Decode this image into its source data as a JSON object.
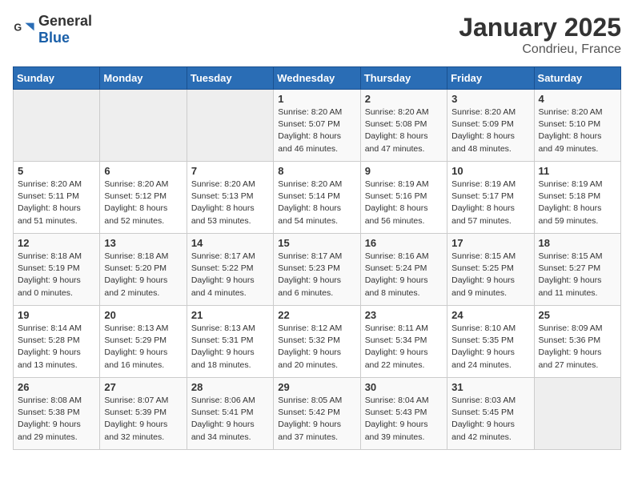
{
  "header": {
    "logo_general": "General",
    "logo_blue": "Blue",
    "month_title": "January 2025",
    "location": "Condrieu, France"
  },
  "days_of_week": [
    "Sunday",
    "Monday",
    "Tuesday",
    "Wednesday",
    "Thursday",
    "Friday",
    "Saturday"
  ],
  "weeks": [
    [
      {
        "day": "",
        "empty": true
      },
      {
        "day": "",
        "empty": true
      },
      {
        "day": "",
        "empty": true
      },
      {
        "day": "1",
        "sunrise": "8:20 AM",
        "sunset": "5:07 PM",
        "daylight": "8 hours and 46 minutes."
      },
      {
        "day": "2",
        "sunrise": "8:20 AM",
        "sunset": "5:08 PM",
        "daylight": "8 hours and 47 minutes."
      },
      {
        "day": "3",
        "sunrise": "8:20 AM",
        "sunset": "5:09 PM",
        "daylight": "8 hours and 48 minutes."
      },
      {
        "day": "4",
        "sunrise": "8:20 AM",
        "sunset": "5:10 PM",
        "daylight": "8 hours and 49 minutes."
      }
    ],
    [
      {
        "day": "5",
        "sunrise": "8:20 AM",
        "sunset": "5:11 PM",
        "daylight": "8 hours and 51 minutes."
      },
      {
        "day": "6",
        "sunrise": "8:20 AM",
        "sunset": "5:12 PM",
        "daylight": "8 hours and 52 minutes."
      },
      {
        "day": "7",
        "sunrise": "8:20 AM",
        "sunset": "5:13 PM",
        "daylight": "8 hours and 53 minutes."
      },
      {
        "day": "8",
        "sunrise": "8:20 AM",
        "sunset": "5:14 PM",
        "daylight": "8 hours and 54 minutes."
      },
      {
        "day": "9",
        "sunrise": "8:19 AM",
        "sunset": "5:16 PM",
        "daylight": "8 hours and 56 minutes."
      },
      {
        "day": "10",
        "sunrise": "8:19 AM",
        "sunset": "5:17 PM",
        "daylight": "8 hours and 57 minutes."
      },
      {
        "day": "11",
        "sunrise": "8:19 AM",
        "sunset": "5:18 PM",
        "daylight": "8 hours and 59 minutes."
      }
    ],
    [
      {
        "day": "12",
        "sunrise": "8:18 AM",
        "sunset": "5:19 PM",
        "daylight": "9 hours and 0 minutes."
      },
      {
        "day": "13",
        "sunrise": "8:18 AM",
        "sunset": "5:20 PM",
        "daylight": "9 hours and 2 minutes."
      },
      {
        "day": "14",
        "sunrise": "8:17 AM",
        "sunset": "5:22 PM",
        "daylight": "9 hours and 4 minutes."
      },
      {
        "day": "15",
        "sunrise": "8:17 AM",
        "sunset": "5:23 PM",
        "daylight": "9 hours and 6 minutes."
      },
      {
        "day": "16",
        "sunrise": "8:16 AM",
        "sunset": "5:24 PM",
        "daylight": "9 hours and 8 minutes."
      },
      {
        "day": "17",
        "sunrise": "8:15 AM",
        "sunset": "5:25 PM",
        "daylight": "9 hours and 9 minutes."
      },
      {
        "day": "18",
        "sunrise": "8:15 AM",
        "sunset": "5:27 PM",
        "daylight": "9 hours and 11 minutes."
      }
    ],
    [
      {
        "day": "19",
        "sunrise": "8:14 AM",
        "sunset": "5:28 PM",
        "daylight": "9 hours and 13 minutes."
      },
      {
        "day": "20",
        "sunrise": "8:13 AM",
        "sunset": "5:29 PM",
        "daylight": "9 hours and 16 minutes."
      },
      {
        "day": "21",
        "sunrise": "8:13 AM",
        "sunset": "5:31 PM",
        "daylight": "9 hours and 18 minutes."
      },
      {
        "day": "22",
        "sunrise": "8:12 AM",
        "sunset": "5:32 PM",
        "daylight": "9 hours and 20 minutes."
      },
      {
        "day": "23",
        "sunrise": "8:11 AM",
        "sunset": "5:34 PM",
        "daylight": "9 hours and 22 minutes."
      },
      {
        "day": "24",
        "sunrise": "8:10 AM",
        "sunset": "5:35 PM",
        "daylight": "9 hours and 24 minutes."
      },
      {
        "day": "25",
        "sunrise": "8:09 AM",
        "sunset": "5:36 PM",
        "daylight": "9 hours and 27 minutes."
      }
    ],
    [
      {
        "day": "26",
        "sunrise": "8:08 AM",
        "sunset": "5:38 PM",
        "daylight": "9 hours and 29 minutes."
      },
      {
        "day": "27",
        "sunrise": "8:07 AM",
        "sunset": "5:39 PM",
        "daylight": "9 hours and 32 minutes."
      },
      {
        "day": "28",
        "sunrise": "8:06 AM",
        "sunset": "5:41 PM",
        "daylight": "9 hours and 34 minutes."
      },
      {
        "day": "29",
        "sunrise": "8:05 AM",
        "sunset": "5:42 PM",
        "daylight": "9 hours and 37 minutes."
      },
      {
        "day": "30",
        "sunrise": "8:04 AM",
        "sunset": "5:43 PM",
        "daylight": "9 hours and 39 minutes."
      },
      {
        "day": "31",
        "sunrise": "8:03 AM",
        "sunset": "5:45 PM",
        "daylight": "9 hours and 42 minutes."
      },
      {
        "day": "",
        "empty": true
      }
    ]
  ]
}
